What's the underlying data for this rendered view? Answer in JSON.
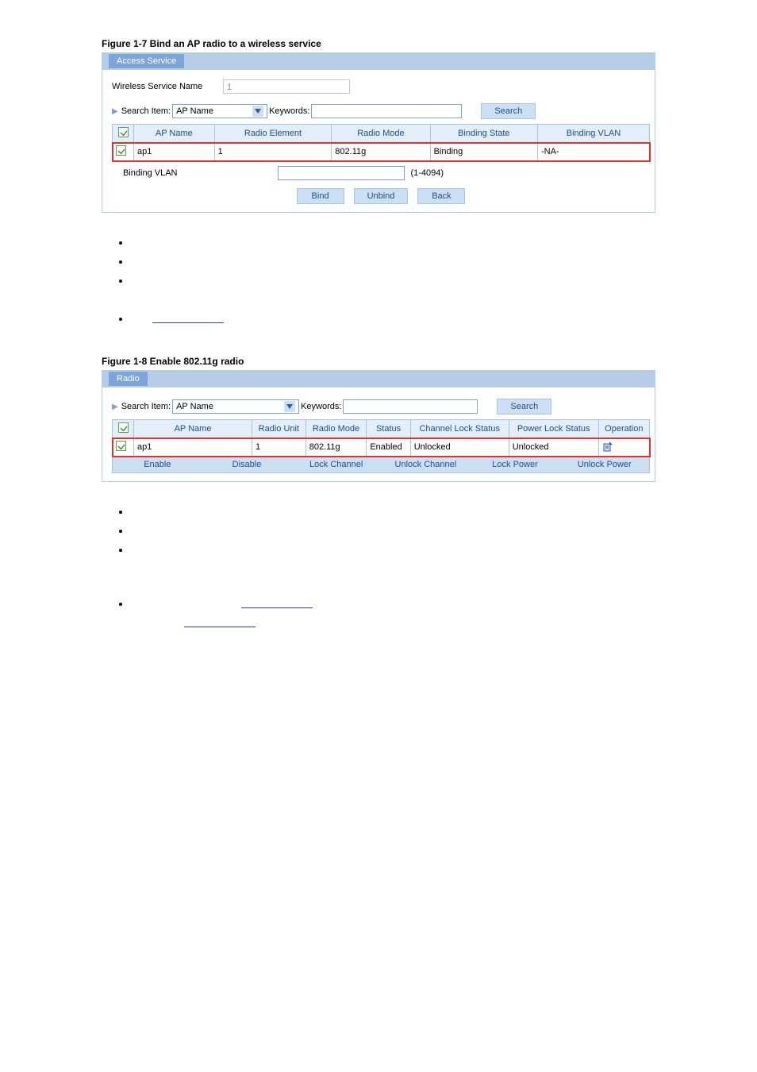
{
  "fig1": {
    "title": "Figure 1-7 Bind an AP radio to a wireless service",
    "panel_tab": "Access Service",
    "wireless_service_name_label": "Wireless Service Name",
    "wireless_service_name_value": "1",
    "search_item_label": "Search Item:",
    "search_item_value": "AP Name",
    "keywords_label": "Keywords:",
    "keywords_value": "",
    "search_btn": "Search",
    "table_headers": [
      "",
      "AP Name",
      "Radio Element",
      "Radio Mode",
      "Binding State",
      "Binding VLAN"
    ],
    "table_row": {
      "ap_name": "ap1",
      "radio_element": "1",
      "radio_mode": "802.11g",
      "binding_state": "Binding",
      "binding_vlan": "-NA-"
    },
    "binding_vlan_label": "Binding VLAN",
    "binding_vlan_range": "(1-4094)",
    "buttons": {
      "bind": "Bind",
      "unbind": "Unbind",
      "back": "Back"
    }
  },
  "fig2": {
    "title": "Figure 1-8 Enable 802.11g radio",
    "panel_tab": "Radio",
    "search_item_label": "Search Item:",
    "search_item_value": "AP Name",
    "keywords_label": "Keywords:",
    "keywords_value": "",
    "search_btn": "Search",
    "table_headers": [
      "",
      "AP Name",
      "Radio Unit",
      "Radio Mode",
      "Status",
      "Channel Lock Status",
      "Power Lock Status",
      "Operation"
    ],
    "table_row": {
      "ap_name": "ap1",
      "radio_unit": "1",
      "radio_mode": "802.11g",
      "status": "Enabled",
      "channel_lock": "Unlocked",
      "power_lock": "Unlocked"
    },
    "bar_buttons": [
      "Enable",
      "Disable",
      "Lock Channel",
      "Unlock Channel",
      "Lock Power",
      "Unlock Power"
    ]
  }
}
